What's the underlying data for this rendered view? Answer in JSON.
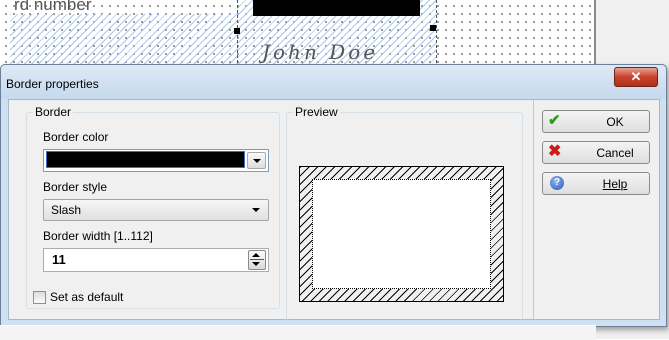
{
  "background": {
    "field_label": "rd number",
    "signature_text": "John Doe"
  },
  "dialog": {
    "title": "Border properties",
    "close_glyph": "✕",
    "border_group": {
      "title": "Border",
      "color_label": "Border color",
      "color_value": "#000000",
      "style_label": "Border style",
      "style_value": "Slash",
      "width_label": "Border width [1..112]",
      "width_value": "11"
    },
    "set_default_label": "Set as default",
    "set_default_checked": false,
    "preview_group": {
      "title": "Preview"
    },
    "buttons": {
      "ok": "OK",
      "cancel": "Cancel",
      "help": "Help"
    },
    "icons": [
      "check-icon",
      "cross-icon",
      "help-icon",
      "chevron-down-icon",
      "close-icon"
    ]
  }
}
